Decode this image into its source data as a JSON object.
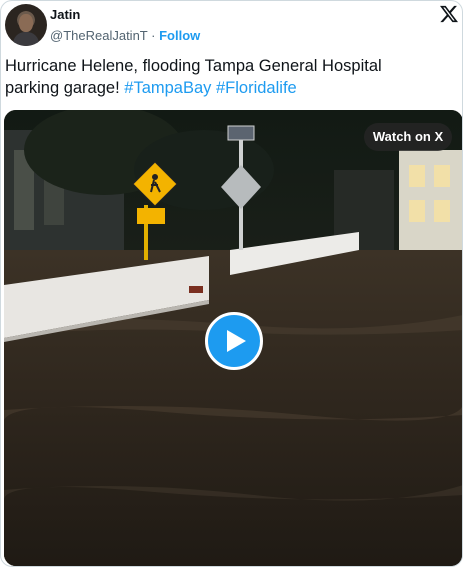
{
  "author": {
    "name": "Jatin",
    "handle": "@TheRealJatinT",
    "separator": "·",
    "follow_label": "Follow"
  },
  "tweet": {
    "text_line1": "Hurricane Helene, flooding Tampa General Hospital",
    "text_line2_prefix": "parking garage!",
    "hashtags": [
      "#TampaBay",
      "#Floridalife"
    ]
  },
  "media": {
    "watch_label": "Watch on X"
  },
  "icons": {
    "logo": "x-logo-icon",
    "play": "play-icon",
    "avatar": "avatar"
  },
  "colors": {
    "accent": "#1d9bf0",
    "text": "#0f1419",
    "muted": "#536471"
  }
}
